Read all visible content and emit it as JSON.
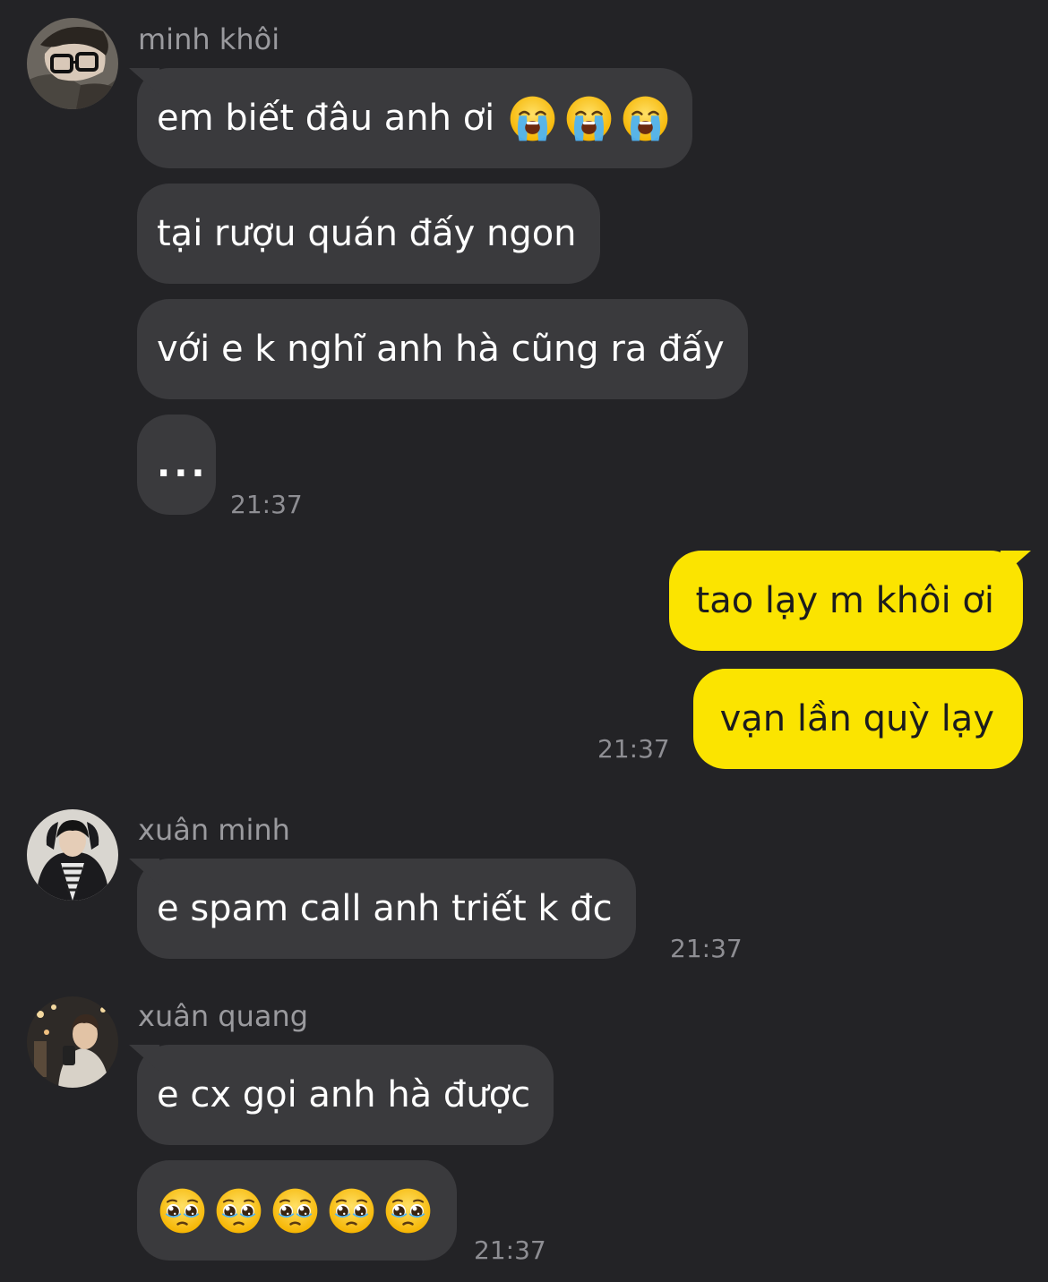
{
  "colors": {
    "background": "#232326",
    "incoming_bubble": "#3a3a3d",
    "outgoing_bubble": "#fbe400",
    "sender_name": "#9a9a9e",
    "timestamp": "#8e8e93"
  },
  "group1": {
    "sender": "minh khôi",
    "avatar_icon": "avatar-minh-khoi",
    "messages": [
      "em biết đâu anh ơi",
      "tại rượu quán đấy ngon",
      "với e k nghĩ anh hà cũng ra đấy",
      "..."
    ],
    "emoji_icon": "loudly-crying-face",
    "time": "21:37"
  },
  "outgoing": {
    "messages": [
      "tao lạy m khôi ơi",
      "vạn lần quỳ lạy"
    ],
    "time": "21:37"
  },
  "group2": {
    "sender": "xuân minh",
    "avatar_icon": "avatar-xuan-minh",
    "messages": [
      "e spam call anh triết k đc"
    ],
    "time": "21:37"
  },
  "group3": {
    "sender": "xuân quang",
    "avatar_icon": "avatar-xuan-quang",
    "messages": [
      "e cx gọi anh hà được"
    ],
    "emoji_icon": "pleading-face",
    "time": "21:37"
  }
}
